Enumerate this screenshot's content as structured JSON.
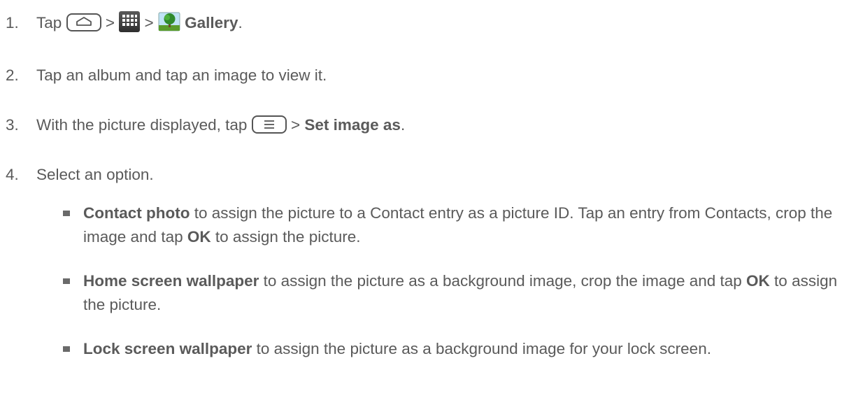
{
  "steps": [
    {
      "num": "1.",
      "text_tap": "Tap",
      "sep1": ">",
      "sep2": ">",
      "gallery": "Gallery",
      "period": "."
    },
    {
      "num": "2.",
      "text": "Tap an album and tap an image to view it."
    },
    {
      "num": "3.",
      "text": "With the picture displayed, tap",
      "sep": ">",
      "bold": "Set image as",
      "period": "."
    },
    {
      "num": "4.",
      "text": "Select an option."
    }
  ],
  "options": [
    {
      "bold": "Contact photo",
      "text1": " to assign the picture to a Contact entry as a picture ID. Tap an entry from Contacts, crop the image and tap ",
      "bold2": "OK",
      "text2": " to assign the picture."
    },
    {
      "bold": "Home screen wallpaper",
      "text1": " to assign the picture as a background image, crop the image and tap ",
      "bold2": "OK",
      "text2": " to assign the picture."
    },
    {
      "bold": "Lock screen wallpaper",
      "text1": " to assign the picture as a background image for your lock screen."
    }
  ],
  "icons": {
    "home_key": "home-key-icon",
    "apps": "apps-grid-icon",
    "gallery": "gallery-tree-icon",
    "menu_key": "menu-key-icon"
  }
}
